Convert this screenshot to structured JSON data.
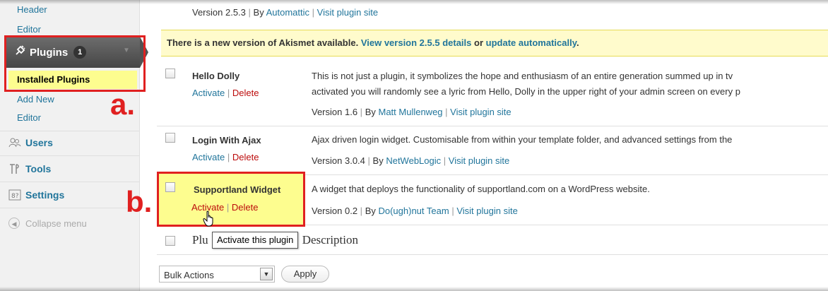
{
  "sidebar": {
    "header_link": "Header",
    "editor_link_top": "Editor",
    "plugins": {
      "label": "Plugins",
      "count": "1",
      "icon": "plug-icon"
    },
    "installed_plugins": "Installed Plugins",
    "add_new": "Add New",
    "editor_link": "Editor",
    "users": {
      "label": "Users",
      "icon": "users-icon"
    },
    "tools": {
      "label": "Tools",
      "icon": "tools-icon"
    },
    "settings": {
      "label": "Settings",
      "icon": "settings-icon"
    },
    "collapse": "Collapse menu"
  },
  "annotations": {
    "a": "a.",
    "b": "b."
  },
  "akismet_meta": {
    "version": "Version 2.5.3",
    "by": "By",
    "author": "Automattic",
    "site": "Visit plugin site"
  },
  "notice": {
    "text": "There is a new version of Akismet available.",
    "details": "View version 2.5.5 details",
    "or": "or",
    "update": "update automatically"
  },
  "plugins": [
    {
      "name": "Hello Dolly",
      "activate": "Activate",
      "delete": "Delete",
      "desc_line1": "This is not just a plugin, it symbolizes the hope and enthusiasm of an entire generation summed up in tv",
      "desc_line2": "activated you will randomly see a lyric from Hello, Dolly in the upper right of your admin screen on every p",
      "version": "Version 1.6",
      "by": "By",
      "author": "Matt Mullenweg",
      "site": "Visit plugin site"
    },
    {
      "name": "Login With Ajax",
      "activate": "Activate",
      "delete": "Delete",
      "desc_line1": "Ajax driven login widget. Customisable from within your template folder, and advanced settings from the",
      "version": "Version 3.0.4",
      "by": "By",
      "author": "NetWebLogic",
      "site": "Visit plugin site"
    },
    {
      "name": "Supportland Widget",
      "activate": "Activate",
      "delete": "Delete",
      "desc_line1": "A widget that deploys the functionality of supportland.com on a WordPress website.",
      "version": "Version 0.2",
      "by": "By",
      "author": "Do(ugh)nut Team",
      "site": "Visit plugin site"
    }
  ],
  "footer": {
    "plugin_col": "Plu",
    "description_col": "Description"
  },
  "tooltip": "Activate this plugin",
  "bulk": {
    "label": "Bulk Actions",
    "apply": "Apply"
  },
  "colors": {
    "link": "#21759b",
    "delete": "#bc0b0b",
    "highlight": "#fdfd8f",
    "annotation": "#e02020",
    "notice_bg": "#fffbcc"
  }
}
